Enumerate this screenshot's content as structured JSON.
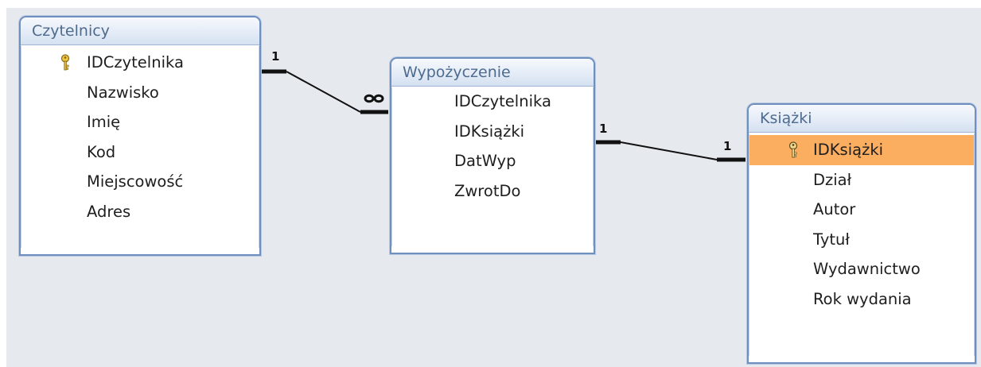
{
  "tables": {
    "czytelnicy": {
      "title": "Czytelnicy",
      "fields": [
        "IDCzytelnika",
        "Nazwisko",
        "Imię",
        "Kod",
        "Miejscowość",
        "Adres"
      ]
    },
    "wypozyczenie": {
      "title": "Wypożyczenie",
      "fields": [
        "IDCzytelnika",
        "IDKsiążki",
        "DatWyp",
        "ZwrotDo"
      ]
    },
    "ksiazki": {
      "title": "Książki",
      "fields": [
        "IDKsiążki",
        "Dział",
        "Autor",
        "Tytuł",
        "Wydawnictwo",
        "Rok wydania"
      ]
    }
  },
  "relationships": {
    "czytelnicy_side": "1",
    "wypozyczenie_side_1": "∞",
    "wypozyczenie_side_2": "1",
    "ksiazki_side": "1"
  },
  "colors": {
    "selected_row": "#fbad60",
    "border": "#6f8fbf",
    "title_text": "#4d6a8f",
    "canvas": "#e6e9ee"
  }
}
